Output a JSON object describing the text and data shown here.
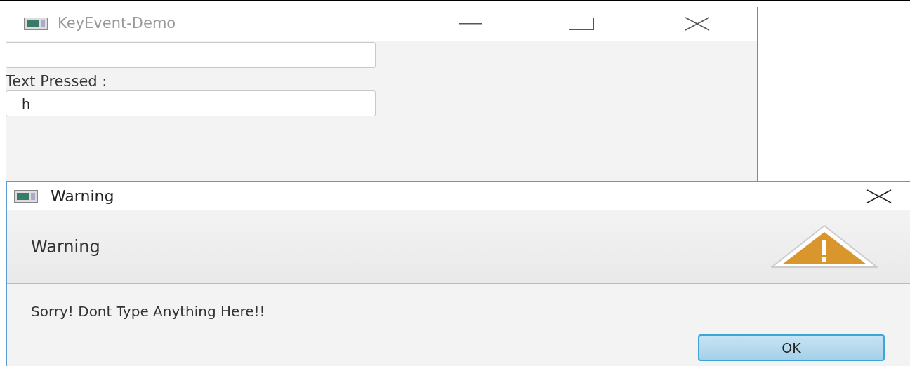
{
  "main_window": {
    "title": "KeyEvent-Demo",
    "controls": [
      {
        "kind": "input"
      },
      {
        "kind": "label",
        "text": "Text Pressed :"
      },
      {
        "kind": "input",
        "value": "h"
      }
    ]
  },
  "dialog": {
    "title": "Warning",
    "header": "Warning",
    "message": "Sorry! Dont Type Anything Here!!",
    "buttons": [
      "OK"
    ]
  }
}
